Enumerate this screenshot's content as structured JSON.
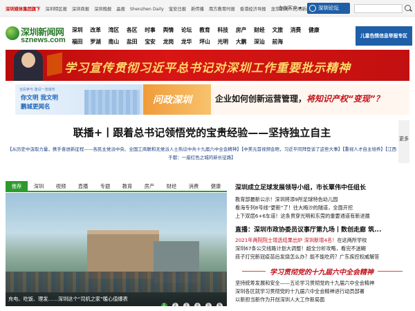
{
  "topbar": {
    "links": [
      "深圳媒体集团旗下",
      "深圳特区报",
      "深圳商报",
      "深圳晚报",
      "晶报",
      "Shenzhen Daily",
      "宝安日报",
      "新传播",
      "南方教育时报",
      "香港经济导报",
      "龙华新闻",
      "光明新闻"
    ],
    "client_label": "合作客户 ▾",
    "forum_label": "深圳论坛",
    "search_placeholder": ""
  },
  "logo": {
    "cn": "深圳新闻网",
    "en": "sznews.com"
  },
  "nav": {
    "row1": [
      "深圳",
      "改革",
      "湾区",
      "各区",
      "时事",
      "舆情",
      "论坛",
      "教育",
      "科技",
      "房产",
      "财经",
      "文旅",
      "消费",
      "健康"
    ],
    "row2": [
      "福田",
      "罗湖",
      "南山",
      "盐田",
      "宝安",
      "龙岗",
      "龙华",
      "坪山",
      "光明",
      "大鹏",
      "深汕",
      "前海"
    ]
  },
  "corner_button": "儿童色情信息举报专区",
  "red_banner": {
    "slogan": "学习宣传贯彻习近平总书记对深圳工作重要批示精神"
  },
  "ad_left": {
    "tag": "全民参与 建设一流城市",
    "line1": "你文明 我文明",
    "line2": "鹏城更闻名"
  },
  "ad_right": {
    "badge": "问政深圳",
    "text_normal": "企业如何创新运营管理，",
    "text_hot": "将知识产权“变现”？"
  },
  "headline": {
    "title": "联播+丨跟着总书记领悟党的宝贵经验——坚持独立自主",
    "sub": "【从历史中汲取力量，携手奋进新征程——各民主党派中央、全国工商联和无党派人士热议中共十九届六中全会精神】【中美元首视频会晤，习近平同拜登谈了这些大事】【重视人才自主培养】【江西于都：一座红色之城的新长征路】",
    "more": "更多"
  },
  "tabs": [
    "推荐",
    "深圳",
    "视频",
    "直播",
    "专题",
    "教育",
    "房产",
    "财经",
    "消费",
    "健康"
  ],
  "slideshow": {
    "caption": "充电、吃饭、理发……深圳这个“司机之家”暖心值爆表",
    "pages": [
      "1",
      "2",
      "3",
      "4",
      "5",
      "6"
    ]
  },
  "right_news": {
    "headline1": "深圳成立足球发展领导小组，市长覃伟中任组长",
    "items1": [
      "教育部最新公示！深圳将添9所足球特色幼儿园",
      "看海专列8号线“更新”了！往大梅沙的隧道，全面开挖",
      "上下双层6+6车道！这条贯穿光明和东莞的重要通道有新进展"
    ],
    "headline2": "直播：深圳市政协委员议事厅第九场丨数创走廊 筑...",
    "items2": [
      {
        "red": "2021年两院院士增选结果出炉 深圳新增4名！",
        "black": "在这两所学校"
      },
      {
        "red": "",
        "black": "深圳67条公交线路计划大调整！超全分析攻略，看完不迷糊"
      },
      {
        "red": "",
        "black": "孩子打完新冠疫苗后发烧怎么办？能不能吃药？广东疾控权威解答"
      }
    ],
    "banner": "学习贯彻党的十九届六中全会精神",
    "items3": [
      "坚持统筹发展和安全——五论学习贯彻党的十九届六中全会精神",
      "深圳各区就学习贯彻党的十九届六中全会精神进行动员部署",
      "以新担当新作为开创深圳人大工作新局面"
    ]
  },
  "colors": {
    "accent_green": "#2c9a2c",
    "brand_blue": "#1e5fa8",
    "banner_red": "#c2111a"
  }
}
